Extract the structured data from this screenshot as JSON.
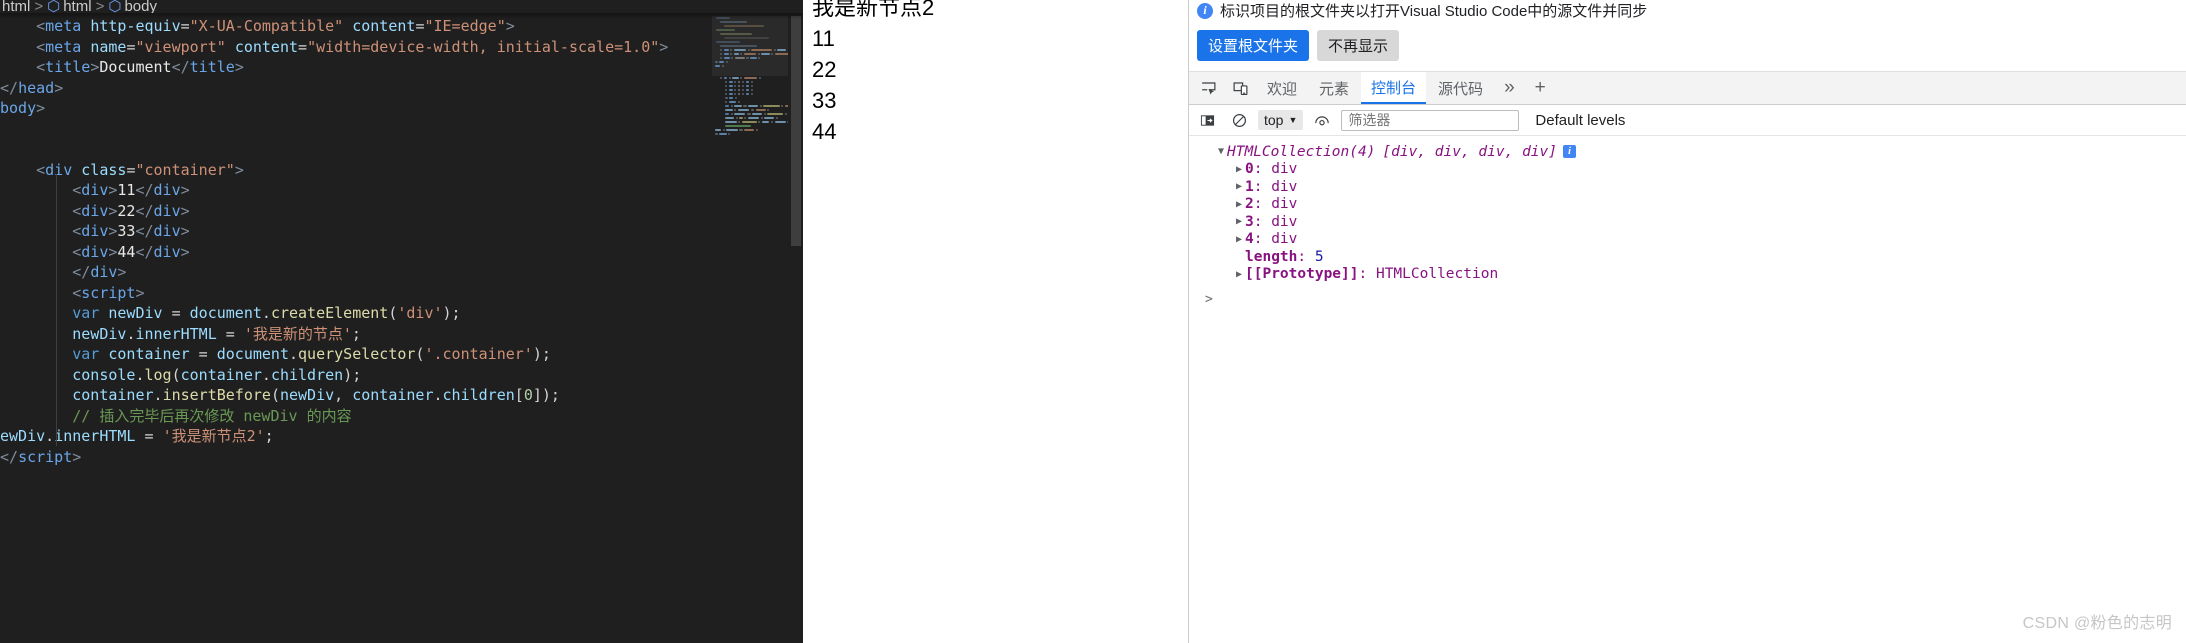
{
  "editor": {
    "breadcrumb": {
      "segments": [
        "html",
        "html",
        "body"
      ],
      "separator": ">"
    },
    "lines": [
      {
        "indent": 4,
        "tokens": [
          {
            "t": "punct",
            "v": "<"
          },
          {
            "t": "tag",
            "v": "meta"
          },
          {
            "t": "txt",
            "v": " "
          },
          {
            "t": "attr",
            "v": "http-equiv"
          },
          {
            "t": "op",
            "v": "="
          },
          {
            "t": "str",
            "v": "\"X-UA-Compatible\""
          },
          {
            "t": "txt",
            "v": " "
          },
          {
            "t": "attr",
            "v": "content"
          },
          {
            "t": "op",
            "v": "="
          },
          {
            "t": "str",
            "v": "\"IE=edge\""
          },
          {
            "t": "punct",
            "v": ">"
          }
        ]
      },
      {
        "indent": 4,
        "tokens": [
          {
            "t": "punct",
            "v": "<"
          },
          {
            "t": "tag",
            "v": "meta"
          },
          {
            "t": "txt",
            "v": " "
          },
          {
            "t": "attr",
            "v": "name"
          },
          {
            "t": "op",
            "v": "="
          },
          {
            "t": "str",
            "v": "\"viewport\""
          },
          {
            "t": "txt",
            "v": " "
          },
          {
            "t": "attr",
            "v": "content"
          },
          {
            "t": "op",
            "v": "="
          },
          {
            "t": "str",
            "v": "\"width=device-width, initial-scale=1.0\""
          },
          {
            "t": "punct",
            "v": ">"
          }
        ]
      },
      {
        "indent": 4,
        "tokens": [
          {
            "t": "punct",
            "v": "<"
          },
          {
            "t": "tag",
            "v": "title"
          },
          {
            "t": "punct",
            "v": ">"
          },
          {
            "t": "white",
            "v": "Document"
          },
          {
            "t": "punct",
            "v": "</"
          },
          {
            "t": "tag",
            "v": "title"
          },
          {
            "t": "punct",
            "v": ">"
          }
        ]
      },
      {
        "indent": 0,
        "tokens": [
          {
            "t": "punct",
            "v": "</"
          },
          {
            "t": "tag",
            "v": "head"
          },
          {
            "t": "punct",
            "v": ">"
          }
        ]
      },
      {
        "indent": 0,
        "tokens": [
          {
            "t": "tag",
            "v": "body"
          },
          {
            "t": "punct",
            "v": ">"
          }
        ]
      },
      {
        "indent": 0,
        "tokens": []
      },
      {
        "indent": 0,
        "tokens": []
      },
      {
        "indent": 4,
        "tokens": [
          {
            "t": "punct",
            "v": "<"
          },
          {
            "t": "tag",
            "v": "div"
          },
          {
            "t": "txt",
            "v": " "
          },
          {
            "t": "attr",
            "v": "class"
          },
          {
            "t": "op",
            "v": "="
          },
          {
            "t": "str",
            "v": "\"container\""
          },
          {
            "t": "punct",
            "v": ">"
          }
        ]
      },
      {
        "indent": 8,
        "tokens": [
          {
            "t": "punct",
            "v": "<"
          },
          {
            "t": "tag",
            "v": "div"
          },
          {
            "t": "punct",
            "v": ">"
          },
          {
            "t": "white",
            "v": "11"
          },
          {
            "t": "punct",
            "v": "</"
          },
          {
            "t": "tag",
            "v": "div"
          },
          {
            "t": "punct",
            "v": ">"
          }
        ]
      },
      {
        "indent": 8,
        "tokens": [
          {
            "t": "punct",
            "v": "<"
          },
          {
            "t": "tag",
            "v": "div"
          },
          {
            "t": "punct",
            "v": ">"
          },
          {
            "t": "white",
            "v": "22"
          },
          {
            "t": "punct",
            "v": "</"
          },
          {
            "t": "tag",
            "v": "div"
          },
          {
            "t": "punct",
            "v": ">"
          }
        ]
      },
      {
        "indent": 8,
        "tokens": [
          {
            "t": "punct",
            "v": "<"
          },
          {
            "t": "tag",
            "v": "div"
          },
          {
            "t": "punct",
            "v": ">"
          },
          {
            "t": "white",
            "v": "33"
          },
          {
            "t": "punct",
            "v": "</"
          },
          {
            "t": "tag",
            "v": "div"
          },
          {
            "t": "punct",
            "v": ">"
          }
        ]
      },
      {
        "indent": 8,
        "tokens": [
          {
            "t": "punct",
            "v": "<"
          },
          {
            "t": "tag",
            "v": "div"
          },
          {
            "t": "punct",
            "v": ">"
          },
          {
            "t": "white",
            "v": "44"
          },
          {
            "t": "punct",
            "v": "</"
          },
          {
            "t": "tag",
            "v": "div"
          },
          {
            "t": "punct",
            "v": ">"
          }
        ]
      },
      {
        "indent": 8,
        "tokens": [
          {
            "t": "punct",
            "v": "</"
          },
          {
            "t": "tag",
            "v": "div"
          },
          {
            "t": "punct",
            "v": ">"
          }
        ]
      },
      {
        "indent": 8,
        "tokens": [
          {
            "t": "punct",
            "v": "<"
          },
          {
            "t": "tag",
            "v": "script"
          },
          {
            "t": "punct",
            "v": ">"
          }
        ]
      },
      {
        "indent": 8,
        "tokens": [
          {
            "t": "kw",
            "v": "var"
          },
          {
            "t": "txt",
            "v": " "
          },
          {
            "t": "var",
            "v": "newDiv"
          },
          {
            "t": "op",
            "v": " = "
          },
          {
            "t": "var",
            "v": "document"
          },
          {
            "t": "op",
            "v": "."
          },
          {
            "t": "fn",
            "v": "createElement"
          },
          {
            "t": "op",
            "v": "("
          },
          {
            "t": "str",
            "v": "'div'"
          },
          {
            "t": "op",
            "v": ");"
          }
        ]
      },
      {
        "indent": 8,
        "tokens": [
          {
            "t": "var",
            "v": "newDiv"
          },
          {
            "t": "op",
            "v": "."
          },
          {
            "t": "prop",
            "v": "innerHTML"
          },
          {
            "t": "op",
            "v": " = "
          },
          {
            "t": "str",
            "v": "'我是新的节点'"
          },
          {
            "t": "op",
            "v": ";"
          }
        ]
      },
      {
        "indent": 8,
        "tokens": [
          {
            "t": "kw",
            "v": "var"
          },
          {
            "t": "txt",
            "v": " "
          },
          {
            "t": "var",
            "v": "container"
          },
          {
            "t": "op",
            "v": " = "
          },
          {
            "t": "var",
            "v": "document"
          },
          {
            "t": "op",
            "v": "."
          },
          {
            "t": "fn",
            "v": "querySelector"
          },
          {
            "t": "op",
            "v": "("
          },
          {
            "t": "str",
            "v": "'.container'"
          },
          {
            "t": "op",
            "v": ");"
          }
        ]
      },
      {
        "indent": 8,
        "tokens": [
          {
            "t": "var",
            "v": "console"
          },
          {
            "t": "op",
            "v": "."
          },
          {
            "t": "fn",
            "v": "log"
          },
          {
            "t": "op",
            "v": "("
          },
          {
            "t": "var",
            "v": "container"
          },
          {
            "t": "op",
            "v": "."
          },
          {
            "t": "prop",
            "v": "children"
          },
          {
            "t": "op",
            "v": ");"
          }
        ]
      },
      {
        "indent": 8,
        "tokens": [
          {
            "t": "var",
            "v": "container"
          },
          {
            "t": "op",
            "v": "."
          },
          {
            "t": "fn",
            "v": "insertBefore"
          },
          {
            "t": "op",
            "v": "("
          },
          {
            "t": "var",
            "v": "newDiv"
          },
          {
            "t": "op",
            "v": ", "
          },
          {
            "t": "var",
            "v": "container"
          },
          {
            "t": "op",
            "v": "."
          },
          {
            "t": "prop",
            "v": "children"
          },
          {
            "t": "op",
            "v": "["
          },
          {
            "t": "num",
            "v": "0"
          },
          {
            "t": "op",
            "v": "]);"
          }
        ]
      },
      {
        "indent": 8,
        "tokens": [
          {
            "t": "comment",
            "v": "// 插入完毕后再次修改 newDiv 的内容"
          }
        ]
      },
      {
        "indent": 0,
        "tokens": [
          {
            "t": "var",
            "v": "ewDiv"
          },
          {
            "t": "op",
            "v": "."
          },
          {
            "t": "prop",
            "v": "innerHTML"
          },
          {
            "t": "op",
            "v": " = "
          },
          {
            "t": "str",
            "v": "'我是新节点2'"
          },
          {
            "t": "op",
            "v": ";"
          }
        ]
      },
      {
        "indent": 0,
        "tokens": [
          {
            "t": "punct",
            "v": "</"
          },
          {
            "t": "tag",
            "v": "script"
          },
          {
            "t": "punct",
            "v": ">"
          }
        ]
      }
    ]
  },
  "viewport": {
    "lines": [
      "我是新节点2",
      "11",
      "22",
      "33",
      "44"
    ]
  },
  "devtools": {
    "banner": {
      "icon": "info-icon",
      "message": "标识项目的根文件夹以打开Visual Studio Code中的源文件并同步",
      "primary_button": "设置根文件夹",
      "secondary_button": "不再显示"
    },
    "tabs": [
      {
        "label": "欢迎",
        "active": false
      },
      {
        "label": "元素",
        "active": false
      },
      {
        "label": "控制台",
        "active": true
      },
      {
        "label": "源代码",
        "active": false
      }
    ],
    "tab_overflow": "»",
    "tab_add": "+",
    "toolbar": {
      "context_select": "top",
      "context_caret": "▼",
      "filter_placeholder": "筛选器",
      "filter_value": "",
      "levels_label": "Default levels"
    },
    "console": {
      "root_arrow": "open",
      "root_label": "HTMLCollection(4)",
      "root_preview": "[div, div, div, div]",
      "root_badge": "i",
      "entries": [
        {
          "index": "0",
          "value": "div"
        },
        {
          "index": "1",
          "value": "div"
        },
        {
          "index": "2",
          "value": "div"
        },
        {
          "index": "3",
          "value": "div"
        },
        {
          "index": "4",
          "value": "div"
        }
      ],
      "length_key": "length",
      "length_value": "5",
      "prototype_key": "[[Prototype]]",
      "prototype_value": "HTMLCollection",
      "prompt": ">"
    },
    "watermark": "CSDN @粉色的志明"
  },
  "colors": {
    "accent": "#1a73e8",
    "editor_bg": "#1f1f1f",
    "panel_bg": "#ffffff",
    "tabbar_bg": "#f3f3f3"
  }
}
